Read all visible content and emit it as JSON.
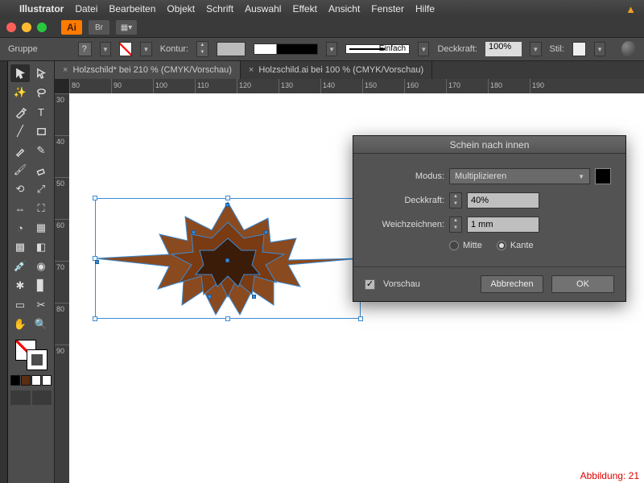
{
  "menubar": {
    "app": "Illustrator",
    "items": [
      "Datei",
      "Bearbeiten",
      "Objekt",
      "Schrift",
      "Auswahl",
      "Effekt",
      "Ansicht",
      "Fenster",
      "Hilfe"
    ]
  },
  "titlebar": {
    "ai": "Ai",
    "br": "Br"
  },
  "controlbar": {
    "selection": "Gruppe",
    "kontur_label": "Kontur:",
    "kontur_val": "",
    "stroke_style": "Einfach",
    "opacity_label": "Deckkraft:",
    "opacity_val": "100%",
    "style_label": "Stil:"
  },
  "tabs": [
    {
      "label": "Holzschild* bei 210 % (CMYK/Vorschau)",
      "active": true
    },
    {
      "label": "Holzschild.ai bei 100 % (CMYK/Vorschau)",
      "active": false
    }
  ],
  "ruler_h": [
    "80",
    "90",
    "100",
    "110",
    "120",
    "130",
    "140",
    "150",
    "160",
    "170",
    "180",
    "190"
  ],
  "ruler_v": [
    "30",
    "40",
    "50",
    "60",
    "70",
    "80",
    "90"
  ],
  "dialog": {
    "title": "Schein nach innen",
    "mode_label": "Modus:",
    "mode_value": "Multiplizieren",
    "opacity_label": "Deckkraft:",
    "opacity_value": "40%",
    "blur_label": "Weichzeichnen:",
    "blur_value": "1 mm",
    "radio_center": "Mitte",
    "radio_edge": "Kante",
    "preview_label": "Vorschau",
    "cancel": "Abbrechen",
    "ok": "OK"
  },
  "caption": "Abbildung: 21",
  "swatches": [
    "#000000",
    "#5a2e12",
    "#ffffff",
    "#ffffff"
  ]
}
